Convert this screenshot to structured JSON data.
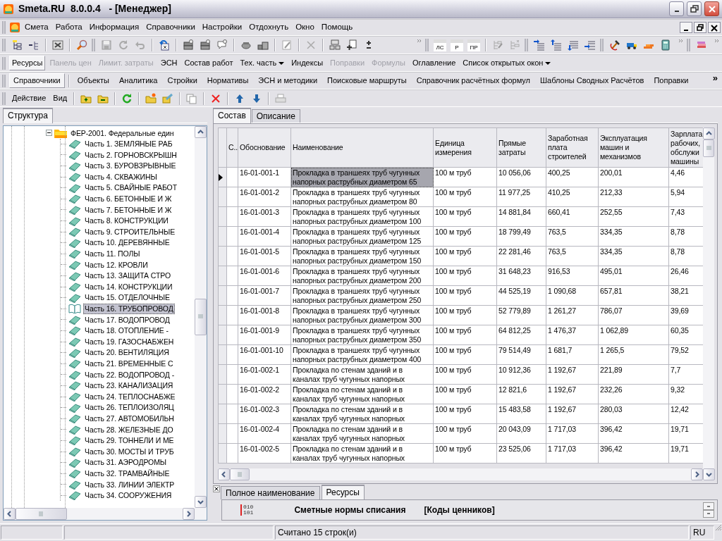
{
  "window": {
    "title": "Smeta.RU  8.0.0.4   - [Менеджер]"
  },
  "menu": [
    "Смета",
    "Работа",
    "Информация",
    "Справочники",
    "Настройки",
    "Отдохнуть",
    "Окно",
    "Помощь"
  ],
  "main_toolbar": {
    "doc_buttons": [
      "ЛС",
      "Р",
      "ПР"
    ]
  },
  "view_toolbar": [
    {
      "label": "Ресурсы",
      "selected": true,
      "disabled": false,
      "dropdown": false
    },
    {
      "label": "Панель цен",
      "selected": false,
      "disabled": true,
      "dropdown": false
    },
    {
      "label": "Лимит. затраты",
      "selected": false,
      "disabled": true,
      "dropdown": false
    },
    {
      "label": "ЭСН",
      "selected": false,
      "disabled": false,
      "dropdown": false
    },
    {
      "label": "Состав работ",
      "selected": false,
      "disabled": false,
      "dropdown": false
    },
    {
      "label": "Тех. часть",
      "selected": false,
      "disabled": false,
      "dropdown": true
    },
    {
      "label": "Индексы",
      "selected": false,
      "disabled": false,
      "dropdown": false
    },
    {
      "label": "Поправки",
      "selected": false,
      "disabled": true,
      "dropdown": false
    },
    {
      "label": "Формулы",
      "selected": false,
      "disabled": true,
      "dropdown": false
    },
    {
      "label": "Оглавление",
      "selected": false,
      "disabled": false,
      "dropdown": false
    },
    {
      "label": "Список открытых окон",
      "selected": false,
      "disabled": false,
      "dropdown": true
    }
  ],
  "section_tabs": {
    "tabs": [
      {
        "label": "Справочники",
        "selected": true
      },
      {
        "label": "Объекты",
        "selected": false
      },
      {
        "label": "Аналитика",
        "selected": false
      },
      {
        "label": "Стройки",
        "selected": false
      },
      {
        "label": "Нормативы",
        "selected": false
      },
      {
        "label": "ЭСН и методики",
        "selected": false
      },
      {
        "label": "Поисковые маршруты",
        "selected": false
      },
      {
        "label": "Справочник расчётных формул",
        "selected": false
      },
      {
        "label": "Шаблоны Сводных Расчётов",
        "selected": false
      },
      {
        "label": "Поправки",
        "selected": false
      }
    ],
    "overflow": "»"
  },
  "action_toolbar": {
    "menus": [
      "Действие",
      "Вид"
    ]
  },
  "structure_panel": {
    "tab": "Структура",
    "tree": {
      "label": "ФЕР-2001. Федеральные един",
      "expanded": true,
      "selected": false,
      "children": [
        {
          "label": "Часть 1. ЗЕМЛЯНЫЕ РАБ",
          "selected": false
        },
        {
          "label": "Часть 2. ГОРНОВСКРЫШН",
          "selected": false
        },
        {
          "label": "Часть 3. БУРОВЗРЫВНЫЕ",
          "selected": false
        },
        {
          "label": "Часть 4. СКВАЖИНЫ",
          "selected": false
        },
        {
          "label": "Часть 5. СВАЙНЫЕ РАБОТ",
          "selected": false
        },
        {
          "label": "Часть 6. БЕТОННЫЕ И Ж",
          "selected": false
        },
        {
          "label": "Часть 7. БЕТОННЫЕ И Ж",
          "selected": false
        },
        {
          "label": "Часть 8. КОНСТРУКЦИИ",
          "selected": false
        },
        {
          "label": "Часть 9. СТРОИТЕЛЬНЫЕ",
          "selected": false
        },
        {
          "label": "Часть 10. ДЕРЕВЯННЫЕ",
          "selected": false
        },
        {
          "label": "Часть 11. ПОЛЫ",
          "selected": false
        },
        {
          "label": "Часть 12. КРОВЛИ",
          "selected": false
        },
        {
          "label": "Часть 13. ЗАЩИТА СТРО",
          "selected": false
        },
        {
          "label": "Часть 14. КОНСТРУКЦИИ",
          "selected": false
        },
        {
          "label": "Часть 15. ОТДЕЛОЧНЫЕ",
          "selected": false
        },
        {
          "label": "Часть 16. ТРУБОПРОВОД",
          "selected": true
        },
        {
          "label": "Часть 17. ВОДОПРОВОД",
          "selected": false
        },
        {
          "label": "Часть 18. ОТОПЛЕНИЕ -",
          "selected": false
        },
        {
          "label": "Часть 19. ГАЗОСНАБЖЕН",
          "selected": false
        },
        {
          "label": "Часть 20. ВЕНТИЛЯЦИЯ",
          "selected": false
        },
        {
          "label": "Часть 21. ВРЕМЕННЫЕ С",
          "selected": false
        },
        {
          "label": "Часть 22. ВОДОПРОВОД -",
          "selected": false
        },
        {
          "label": "Часть 23. КАНАЛИЗАЦИЯ",
          "selected": false
        },
        {
          "label": "Часть 24. ТЕПЛОСНАБЖЕ",
          "selected": false
        },
        {
          "label": "Часть 26. ТЕПЛОИЗОЛЯЦ",
          "selected": false
        },
        {
          "label": "Часть 27. АВТОМОБИЛЬН",
          "selected": false
        },
        {
          "label": "Часть 28. ЖЕЛЕЗНЫЕ ДО",
          "selected": false
        },
        {
          "label": "Часть 29. ТОННЕЛИ И МЕ",
          "selected": false
        },
        {
          "label": "Часть 30. МОСТЫ И ТРУБ",
          "selected": false
        },
        {
          "label": "Часть 31. АЭРОДРОМЫ",
          "selected": false
        },
        {
          "label": "Часть 32. ТРАМВАЙНЫЕ",
          "selected": false
        },
        {
          "label": "Часть 33. ЛИНИИ ЭЛЕКТР",
          "selected": false
        },
        {
          "label": "Часть 34. СООРУЖЕНИЯ",
          "selected": false
        }
      ]
    }
  },
  "detail_tabs": [
    {
      "label": "Состав",
      "selected": true
    },
    {
      "label": "Описание",
      "selected": false
    }
  ],
  "table": {
    "columns": [
      "С..",
      "Обоснование",
      "Наименование",
      "Единица измерения",
      "Прямые затраты",
      "Заработная плата строителей",
      "Эксплуатация машин и механизмов",
      "Зарплата рабочих, обслужи машины"
    ],
    "rows": [
      {
        "selected": true,
        "cells": [
          "",
          "16-01-001-1",
          "Прокладка в траншеях труб чугунных напорных раструбных диаметром 65",
          "100 м труб",
          "10 056,06",
          "400,25",
          "200,01",
          "4,46"
        ]
      },
      {
        "selected": false,
        "cells": [
          "",
          "16-01-001-2",
          "Прокладка в траншеях труб чугунных напорных раструбных диаметром 80",
          "100 м труб",
          "11 977,25",
          "410,25",
          "212,33",
          "5,94"
        ]
      },
      {
        "selected": false,
        "cells": [
          "",
          "16-01-001-3",
          "Прокладка в траншеях труб чугунных напорных раструбных диаметром 100",
          "100 м труб",
          "14 881,84",
          "660,41",
          "252,55",
          "7,43"
        ]
      },
      {
        "selected": false,
        "cells": [
          "",
          "16-01-001-4",
          "Прокладка в траншеях труб чугунных напорных раструбных диаметром 125",
          "100 м труб",
          "18 799,49",
          "763,5",
          "334,35",
          "8,78"
        ]
      },
      {
        "selected": false,
        "cells": [
          "",
          "16-01-001-5",
          "Прокладка в траншеях труб чугунных напорных раструбных диаметром 150",
          "100 м труб",
          "22 281,46",
          "763,5",
          "334,35",
          "8,78"
        ]
      },
      {
        "selected": false,
        "cells": [
          "",
          "16-01-001-6",
          "Прокладка в траншеях труб чугунных напорных раструбных диаметром 200",
          "100 м труб",
          "31 648,23",
          "916,53",
          "495,01",
          "26,46"
        ]
      },
      {
        "selected": false,
        "cells": [
          "",
          "16-01-001-7",
          "Прокладка в траншеях труб чугунных напорных раструбных диаметром 250",
          "100 м труб",
          "44 525,19",
          "1 090,68",
          "657,81",
          "38,21"
        ]
      },
      {
        "selected": false,
        "cells": [
          "",
          "16-01-001-8",
          "Прокладка в траншеях труб чугунных напорных раструбных диаметром 300",
          "100 м труб",
          "52 779,89",
          "1 261,27",
          "786,07",
          "39,69"
        ]
      },
      {
        "selected": false,
        "cells": [
          "",
          "16-01-001-9",
          "Прокладка в траншеях труб чугунных напорных раструбных диаметром 350",
          "100 м труб",
          "64 812,25",
          "1 476,37",
          "1 062,89",
          "60,35"
        ]
      },
      {
        "selected": false,
        "cells": [
          "",
          "16-01-001-10",
          "Прокладка в траншеях труб чугунных напорных раструбных диаметром 400",
          "100 м труб",
          "79 514,49",
          "1 681,7",
          "1 265,5",
          "79,52"
        ]
      },
      {
        "selected": false,
        "cells": [
          "",
          "16-01-002-1",
          "Прокладка по стенам зданий и в каналах труб чугунных напорных",
          "100 м труб",
          "10 912,36",
          "1 192,67",
          "221,89",
          "7,7"
        ]
      },
      {
        "selected": false,
        "cells": [
          "",
          "16-01-002-2",
          "Прокладка по стенам зданий и в каналах труб чугунных напорных",
          "100 м труб",
          "12 821,6",
          "1 192,67",
          "232,26",
          "9,32"
        ]
      },
      {
        "selected": false,
        "cells": [
          "",
          "16-01-002-3",
          "Прокладка по стенам зданий и в каналах труб чугунных напорных",
          "100 м труб",
          "15 483,58",
          "1 192,67",
          "280,03",
          "12,42"
        ]
      },
      {
        "selected": false,
        "cells": [
          "",
          "16-01-002-4",
          "Прокладка по стенам зданий и в каналах труб чугунных напорных",
          "100 м труб",
          "20 043,09",
          "1 717,03",
          "396,42",
          "19,71"
        ]
      },
      {
        "selected": false,
        "cells": [
          "",
          "16-01-002-5",
          "Прокладка по стенам зданий и в каналах труб чугунных напорных",
          "100 м труб",
          "23 525,06",
          "1 717,03",
          "396,42",
          "19,71"
        ]
      }
    ]
  },
  "bottom_tabs": [
    {
      "label": "Полное наименование",
      "selected": false
    },
    {
      "label": "Ресурсы",
      "selected": true
    }
  ],
  "resources_bar": {
    "icon_lines": [
      "010",
      "101"
    ],
    "title": "Сметные нормы списания",
    "subtitle": "[Коды ценников]"
  },
  "status_bar": {
    "message": "Считано 15 строк(и)",
    "language": "RU"
  }
}
